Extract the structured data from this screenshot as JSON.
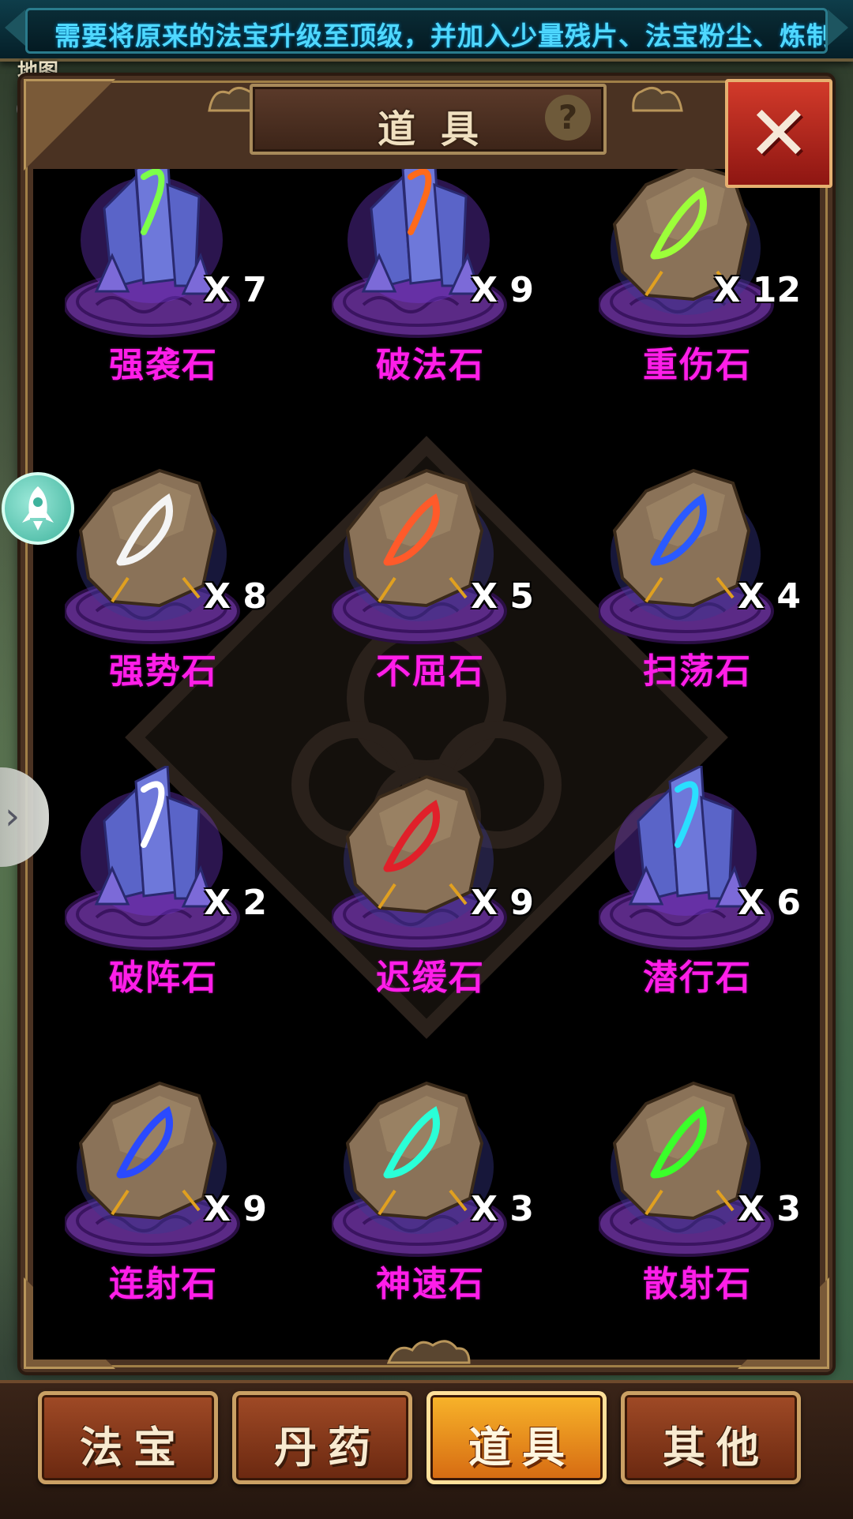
{
  "marquee": {
    "text": "需要将原来的法宝升级至顶级，并加入少量残片、法宝粉尘、炼制"
  },
  "map_label": "地图",
  "panel": {
    "title": "道具",
    "help": "?",
    "close": "✕"
  },
  "items": [
    {
      "name": "强袭石",
      "qty": "X 7",
      "kind": "crystal",
      "glow": "#7a3ce0",
      "rune": "#7cff4a"
    },
    {
      "name": "破法石",
      "qty": "X 9",
      "kind": "crystal",
      "glow": "#7a3ce0",
      "rune": "#ff6a1a"
    },
    {
      "name": "重伤石",
      "qty": "X 12",
      "kind": "rock",
      "glow": "#3a3a90",
      "rune": "#9cff3a"
    },
    {
      "name": "强势石",
      "qty": "X 8",
      "kind": "rock",
      "glow": "#3a3a90",
      "rune": "#f4f4f4"
    },
    {
      "name": "不屈石",
      "qty": "X 5",
      "kind": "rock",
      "glow": "#3a3a90",
      "rune": "#ff5a2a"
    },
    {
      "name": "扫荡石",
      "qty": "X 4",
      "kind": "rock",
      "glow": "#3a3a90",
      "rune": "#2a5aff"
    },
    {
      "name": "破阵石",
      "qty": "X 2",
      "kind": "crystal",
      "glow": "#7a3ce0",
      "rune": "#ffffff"
    },
    {
      "name": "迟缓石",
      "qty": "X 9",
      "kind": "rock",
      "glow": "#3a3a90",
      "rune": "#e0202a"
    },
    {
      "name": "潜行石",
      "qty": "X 6",
      "kind": "crystal",
      "glow": "#7a3ce0",
      "rune": "#2adfff"
    },
    {
      "name": "连射石",
      "qty": "X 9",
      "kind": "rock",
      "glow": "#3a3a90",
      "rune": "#2a4aff"
    },
    {
      "name": "神速石",
      "qty": "X 3",
      "kind": "rock",
      "glow": "#3a3a90",
      "rune": "#2affd8"
    },
    {
      "name": "散射石",
      "qty": "X 3",
      "kind": "rock",
      "glow": "#3a3a90",
      "rune": "#3aff2a"
    }
  ],
  "tabs": [
    {
      "label": "法宝",
      "active": false
    },
    {
      "label": "丹药",
      "active": false
    },
    {
      "label": "道具",
      "active": true
    },
    {
      "label": "其他",
      "active": false
    }
  ],
  "colors": {
    "item_name": "#ff1ee8",
    "marquee_text": "#4fd8ff",
    "active_tab": "#f8b42a"
  }
}
